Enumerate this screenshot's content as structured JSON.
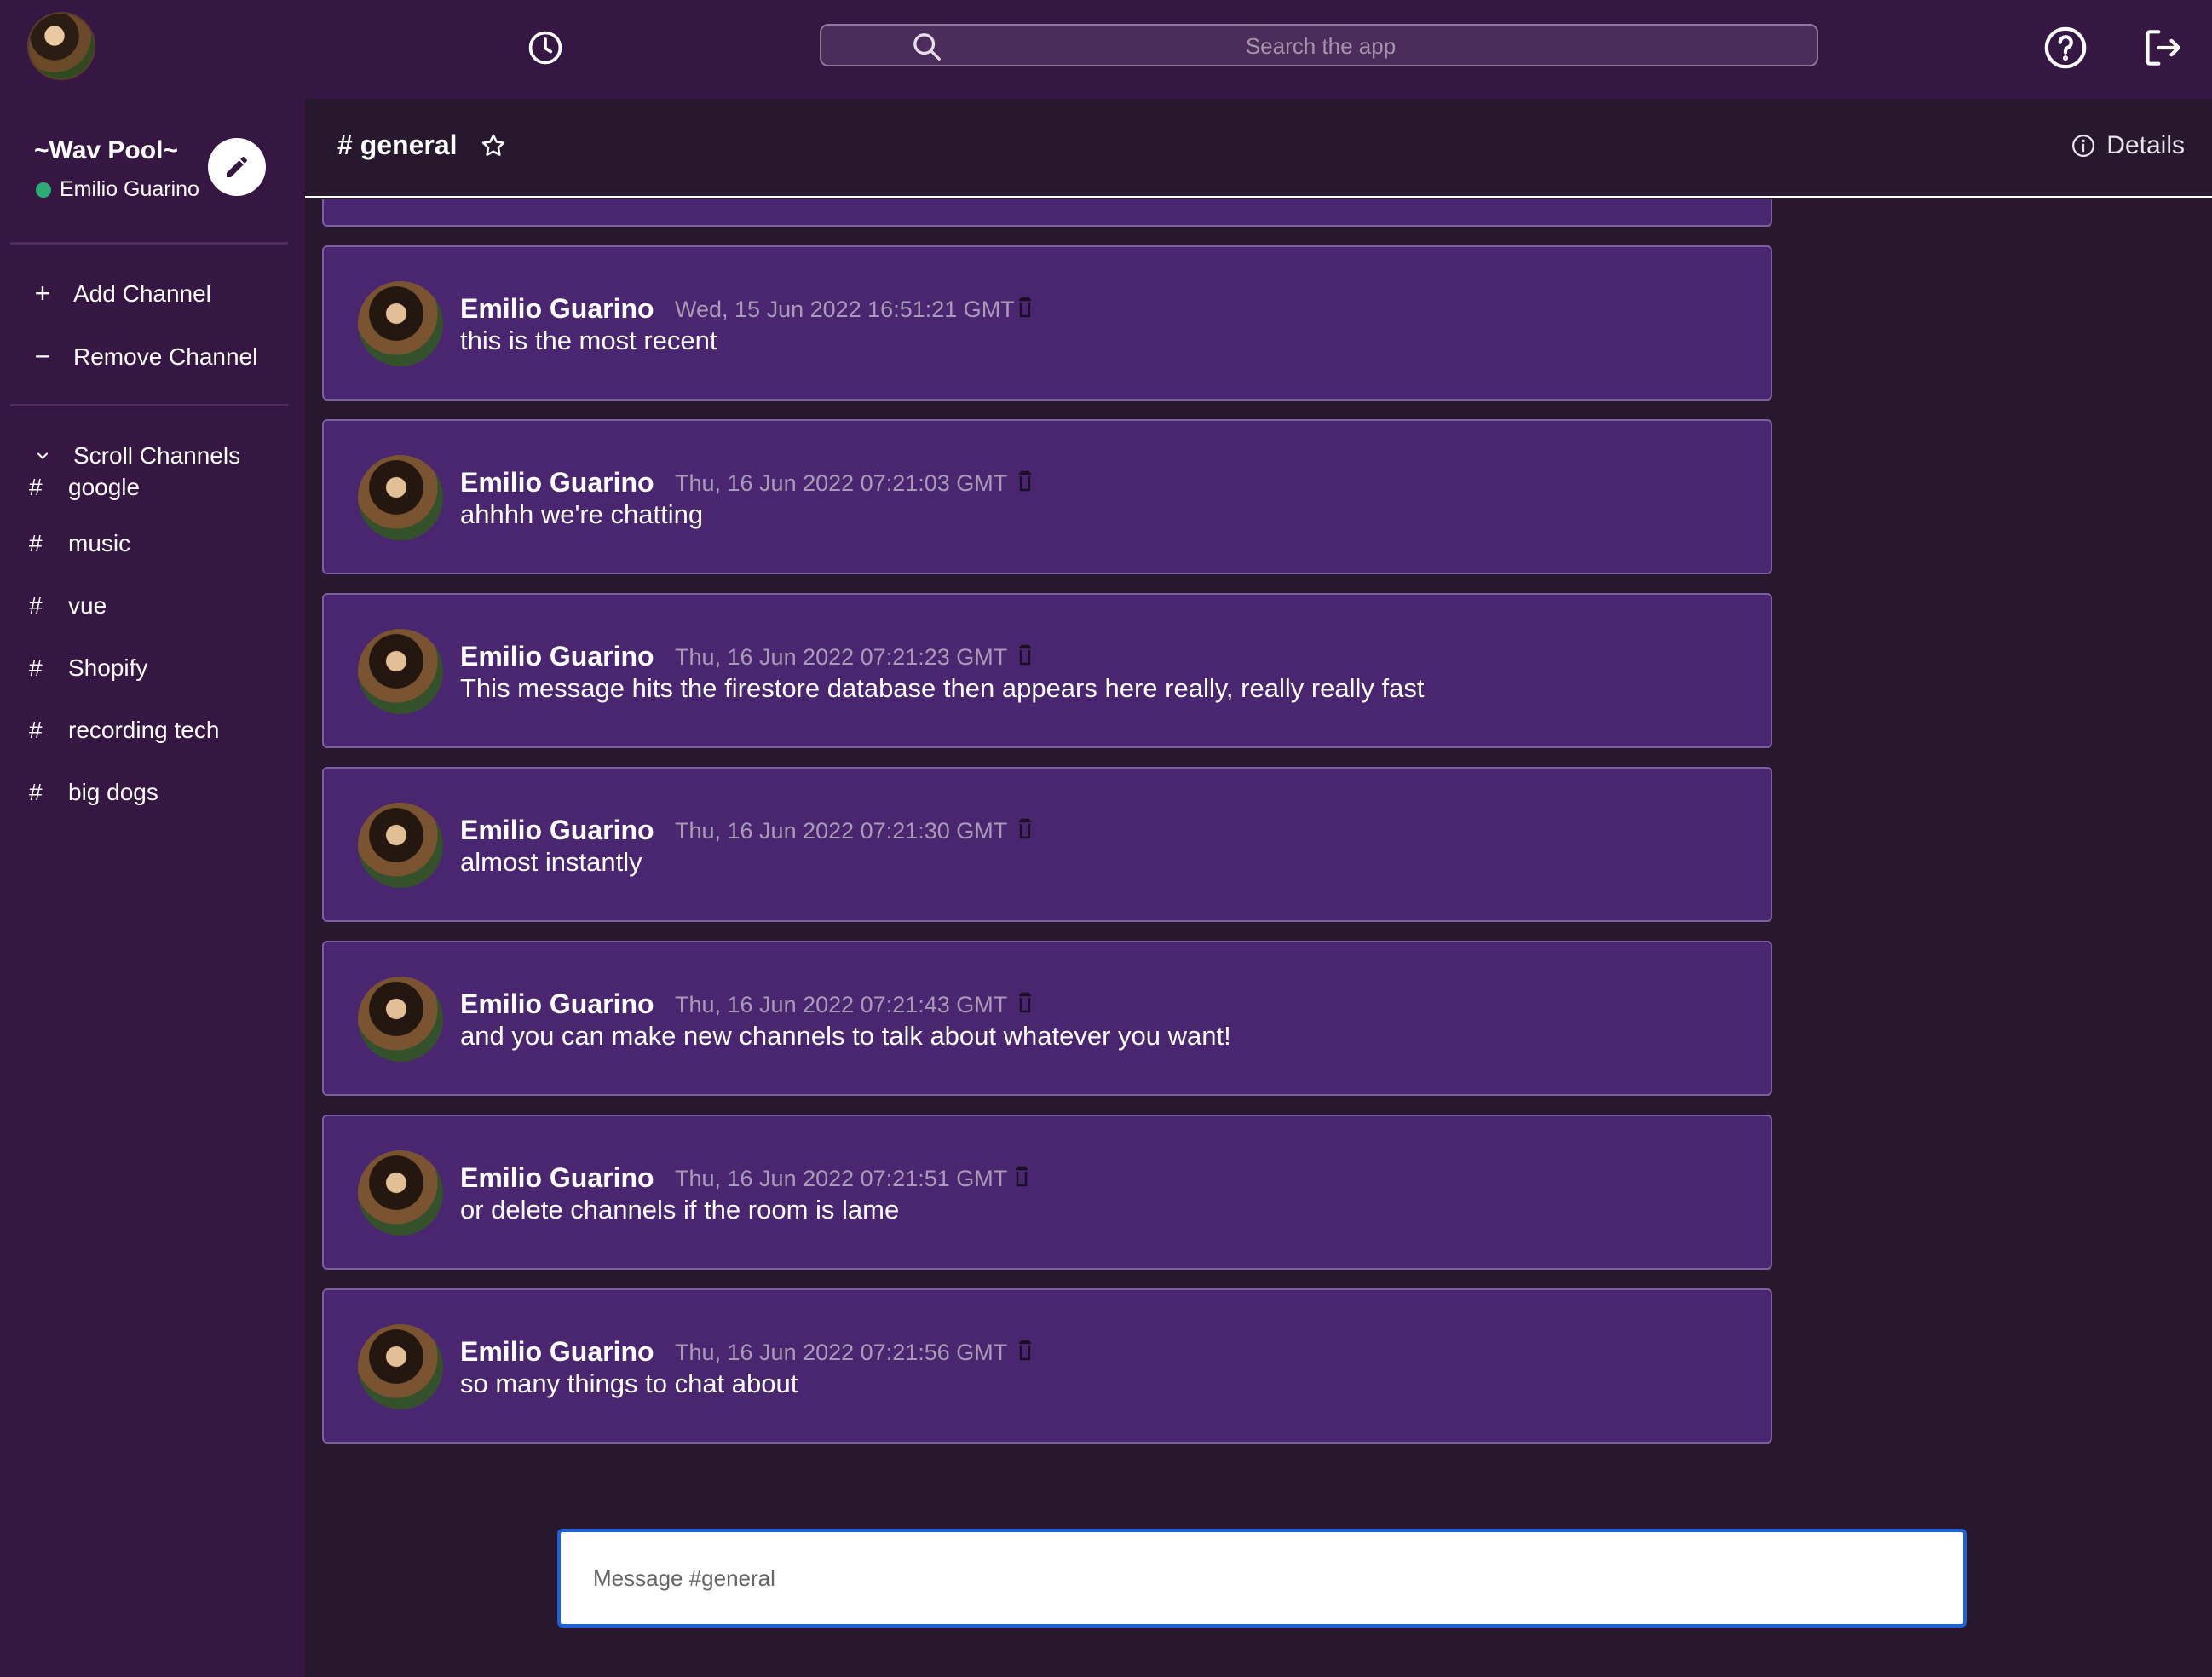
{
  "topbar": {
    "search_placeholder": "Search the app"
  },
  "sidebar": {
    "workspace_name": "~Wav Pool~",
    "user_name": "Emilio Guarino",
    "actions": [
      {
        "label": "Add Channel",
        "glyph": "+"
      },
      {
        "label": "Remove Channel",
        "glyph": "−"
      }
    ],
    "scroll_label": "Scroll Channels",
    "channels": [
      {
        "label": "google"
      },
      {
        "label": "music"
      },
      {
        "label": "vue"
      },
      {
        "label": "Shopify"
      },
      {
        "label": "recording tech"
      },
      {
        "label": "big dogs"
      }
    ]
  },
  "channel": {
    "title": "# general",
    "details_label": "Details"
  },
  "messages": [
    {
      "author": "Emilio Guarino",
      "time": "Wed, 15 Jun 2022 16:51:21 GMT",
      "text": "this is the most recent"
    },
    {
      "author": "Emilio Guarino",
      "time": "Thu, 16 Jun 2022 07:21:03 GMT",
      "text": "ahhhh we're chatting"
    },
    {
      "author": "Emilio Guarino",
      "time": "Thu, 16 Jun 2022 07:21:23 GMT",
      "text": "This message hits the firestore database then appears here really, really really fast"
    },
    {
      "author": "Emilio Guarino",
      "time": "Thu, 16 Jun 2022 07:21:30 GMT",
      "text": "almost instantly"
    },
    {
      "author": "Emilio Guarino",
      "time": "Thu, 16 Jun 2022 07:21:43 GMT",
      "text": "and you can make new channels to talk about whatever you want!"
    },
    {
      "author": "Emilio Guarino",
      "time": "Thu, 16 Jun 2022 07:21:51 GMT",
      "text": "or delete channels if the room is lame"
    },
    {
      "author": "Emilio Guarino",
      "time": "Thu, 16 Jun 2022 07:21:56 GMT",
      "text": "so many things to chat about"
    }
  ],
  "composer": {
    "placeholder": "Message #general"
  }
}
